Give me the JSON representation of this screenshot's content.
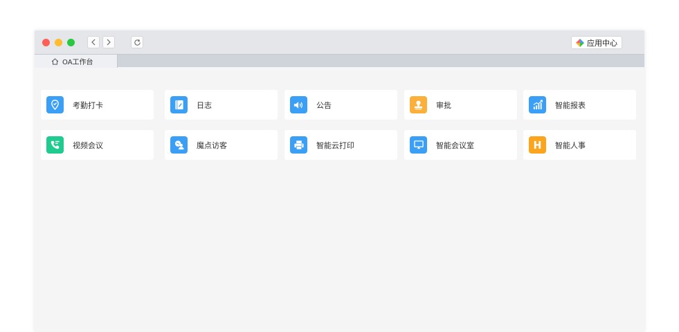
{
  "toolbar": {
    "app_center_label": "应用中心"
  },
  "tabs": [
    {
      "label": "OA工作台",
      "icon": "home-icon"
    }
  ],
  "apps": [
    {
      "label": "考勤打卡",
      "icon": "location-check-icon",
      "color": "#3a9ff5"
    },
    {
      "label": "日志",
      "icon": "notebook-icon",
      "color": "#3a9ff5"
    },
    {
      "label": "公告",
      "icon": "speaker-icon",
      "color": "#3a9ff5"
    },
    {
      "label": "审批",
      "icon": "stamp-icon",
      "color": "#fbb03b"
    },
    {
      "label": "智能报表",
      "icon": "chart-icon",
      "color": "#3a9ff5"
    },
    {
      "label": "视频会议",
      "icon": "video-call-icon",
      "color": "#1fcb8f"
    },
    {
      "label": "魔点访客",
      "icon": "visitor-icon",
      "color": "#3a9ff5"
    },
    {
      "label": "智能云打印",
      "icon": "printer-icon",
      "color": "#3a9ff5"
    },
    {
      "label": "智能会议室",
      "icon": "screen-icon",
      "color": "#3a9ff5"
    },
    {
      "label": "智能人事",
      "icon": "hr-icon",
      "color": "#fba51e"
    }
  ]
}
